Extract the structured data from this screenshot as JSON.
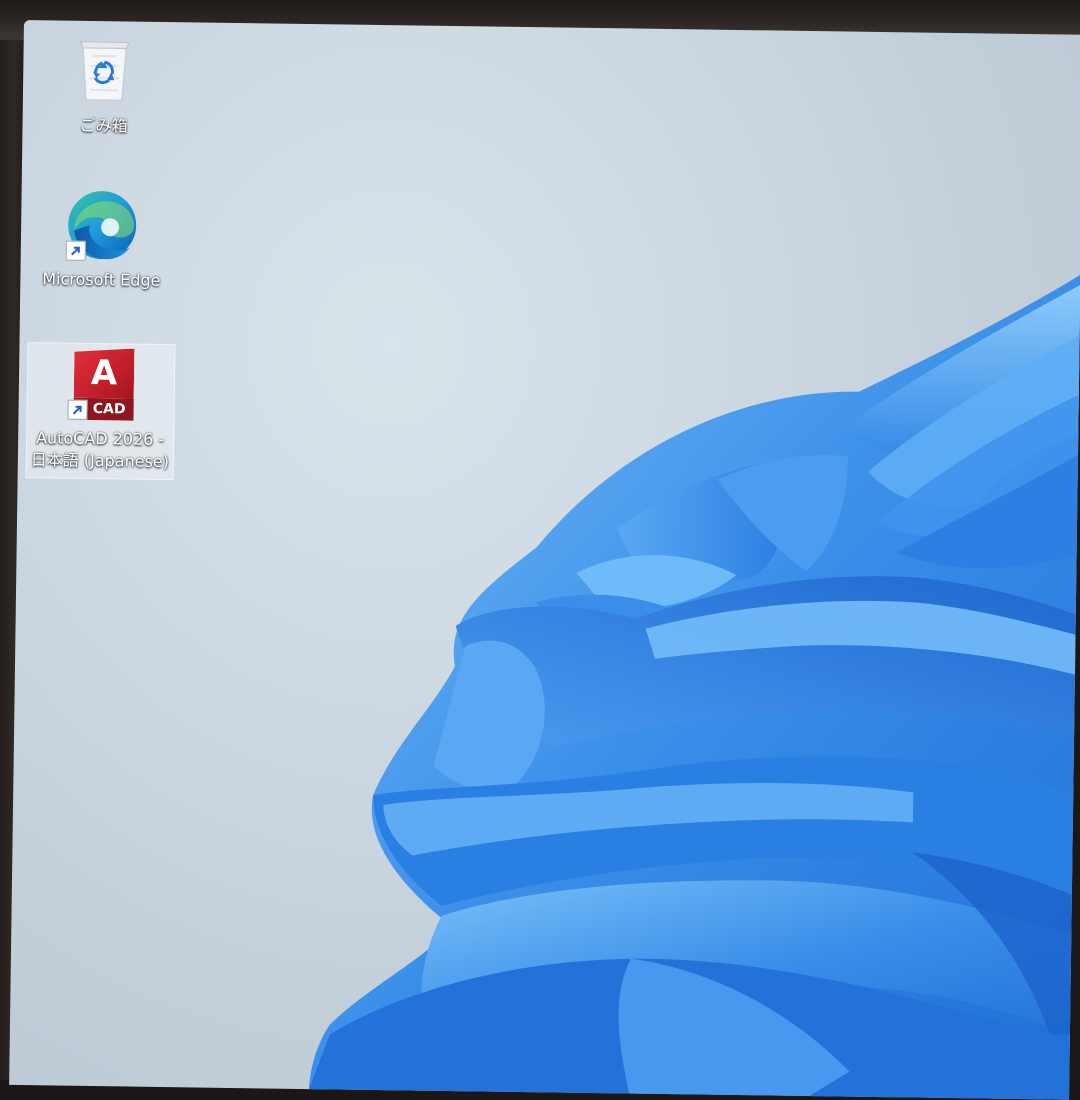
{
  "desktop": {
    "icons": [
      {
        "label": "ごみ箱",
        "icon": "recycle-bin-icon"
      },
      {
        "label": "Microsoft Edge",
        "icon": "edge-icon"
      },
      {
        "label_line1": "AutoCAD 2026 -",
        "label_line2": "日本語 (Japanese)",
        "icon": "autocad-icon",
        "badge_text": "CAD",
        "glyph": "A",
        "selected": true
      }
    ]
  },
  "colors": {
    "wallpaper_background": "#cdd8e1",
    "bloom_blue": "#2f86e6",
    "bloom_light": "#6cb6f7",
    "autocad_red": "#c21f2b"
  }
}
